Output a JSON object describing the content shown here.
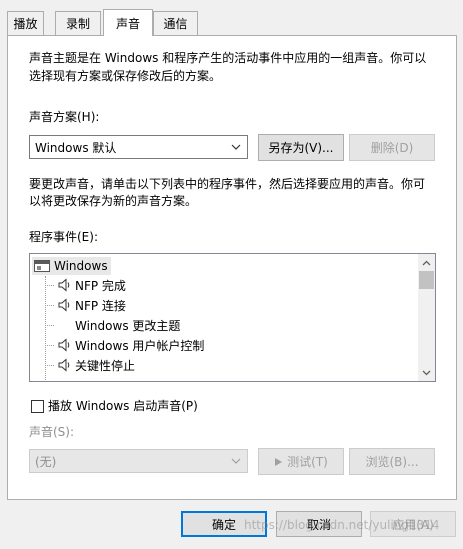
{
  "tabs": [
    {
      "label": "播放",
      "active": false
    },
    {
      "label": "录制",
      "active": false
    },
    {
      "label": "声音",
      "active": true
    },
    {
      "label": "通信",
      "active": false
    }
  ],
  "description": {
    "line1": "声音主题是在 Windows 和程序产生的活动事件中应用的一组声音。你可以",
    "line2": "选择现有方案或保存修改后的方案。"
  },
  "scheme": {
    "label": "声音方案(H):",
    "selected": "Windows 默认",
    "save_as_label": "另存为(V)...",
    "delete_label": "删除(D)"
  },
  "instruction": {
    "line1": "要更改声音，请单击以下列表中的程序事件，然后选择要应用的声音。你可",
    "line2": "以将更改保存为新的声音方案。"
  },
  "events": {
    "label": "程序事件(E):",
    "root": "Windows",
    "items": [
      {
        "label": "NFP 完成",
        "has_sound": true
      },
      {
        "label": "NFP 连接",
        "has_sound": true
      },
      {
        "label": "Windows 更改主题",
        "has_sound": false
      },
      {
        "label": "Windows 用户帐户控制",
        "has_sound": true
      },
      {
        "label": "关键性停止",
        "has_sound": true
      }
    ]
  },
  "startup": {
    "label": "播放 Windows 启动声音(P)",
    "checked": false
  },
  "sounds": {
    "label": "声音(S):",
    "selected": "(无)",
    "test_label": "测试(T)",
    "browse_label": "浏览(B)..."
  },
  "dialog_buttons": {
    "ok": "确定",
    "cancel": "取消",
    "apply": "应用(A)"
  },
  "watermark": "https://blog.csdn.net/yuling1314",
  "colors": {
    "accent": "#0078d7",
    "tab_border": "#adadad",
    "disabled_text": "#8f8f8f"
  }
}
